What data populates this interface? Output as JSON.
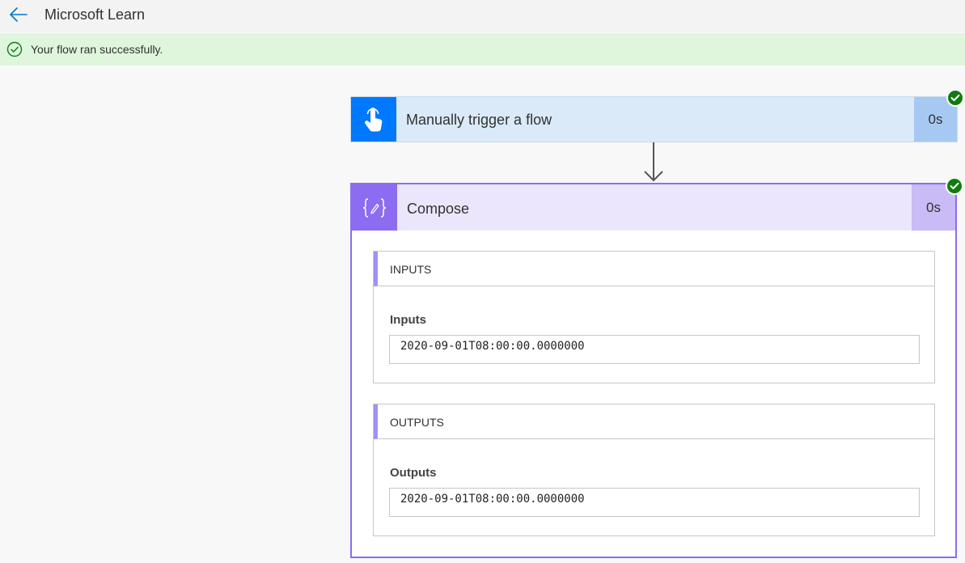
{
  "header": {
    "back_icon": "arrow-left-icon",
    "title": "Microsoft Learn"
  },
  "banner": {
    "icon": "check-circle-icon",
    "text": "Your flow ran successfully.",
    "background": "#dff6dd"
  },
  "trigger_card": {
    "title": "Manually trigger a flow",
    "duration": "0s",
    "icon": "touch-hand-icon",
    "accent": "#0078ff",
    "status": "succeeded"
  },
  "compose_card": {
    "title": "Compose",
    "duration": "0s",
    "icon": "compose-braces-icon",
    "accent": "#8c6cf0",
    "status": "succeeded",
    "inputs": {
      "section_title": "INPUTS",
      "label": "Inputs",
      "value": "2020-09-01T08:00:00.0000000"
    },
    "outputs": {
      "section_title": "OUTPUTS",
      "label": "Outputs",
      "value": "2020-09-01T08:00:00.0000000"
    }
  },
  "colors": {
    "success": "#107c10",
    "link_blue": "#0078d4"
  }
}
